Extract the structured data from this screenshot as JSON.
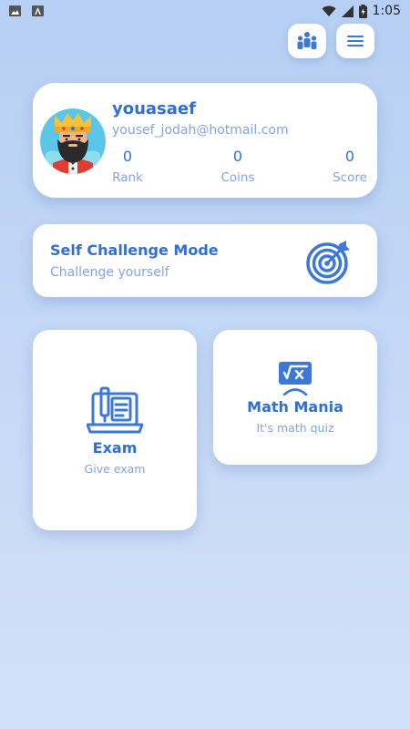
{
  "status_bar": {
    "time": "1:05"
  },
  "profile": {
    "username": "youasaef",
    "email": "yousef_jodah@hotmail.com",
    "stats": [
      {
        "value": "0",
        "label": "Rank"
      },
      {
        "value": "0",
        "label": "Coins"
      },
      {
        "value": "0",
        "label": "Score"
      }
    ]
  },
  "challenge": {
    "title": "Self Challenge Mode",
    "subtitle": "Challenge yourself",
    "icon": "target-icon"
  },
  "tiles": {
    "exam": {
      "title": "Exam",
      "subtitle": "Give exam",
      "icon": "laptop-exam-icon"
    },
    "math": {
      "title": "Math Mania",
      "subtitle": "It's math quiz",
      "icon": "math-board-icon"
    }
  },
  "colors": {
    "accent": "#2f6fd6",
    "muted": "#86a3d9",
    "background": "#c3d7f6"
  }
}
